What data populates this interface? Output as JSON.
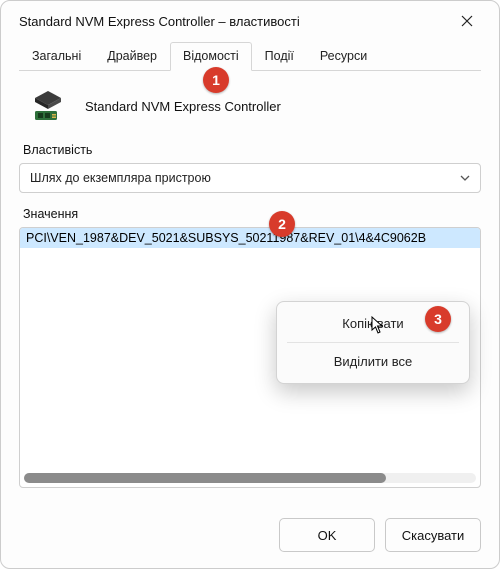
{
  "window": {
    "title": "Standard NVM Express Controller – властивості"
  },
  "tabs": {
    "items": [
      {
        "label": "Загальні"
      },
      {
        "label": "Драйвер"
      },
      {
        "label": "Відомості"
      },
      {
        "label": "Події"
      },
      {
        "label": "Ресурси"
      }
    ],
    "active_index": 2
  },
  "device": {
    "name": "Standard NVM Express Controller"
  },
  "property": {
    "label": "Властивість",
    "selected": "Шлях до екземпляра пристрою"
  },
  "value": {
    "label": "Значення",
    "items": [
      "PCI\\VEN_1987&DEV_5021&SUBSYS_50211987&REV_01\\4&4C9062B"
    ]
  },
  "context_menu": {
    "items": [
      {
        "label": "Копіювати"
      },
      {
        "label": "Виділити все"
      }
    ]
  },
  "buttons": {
    "ok": "OK",
    "cancel": "Скасувати"
  },
  "badges": {
    "b1": "1",
    "b2": "2",
    "b3": "3"
  }
}
